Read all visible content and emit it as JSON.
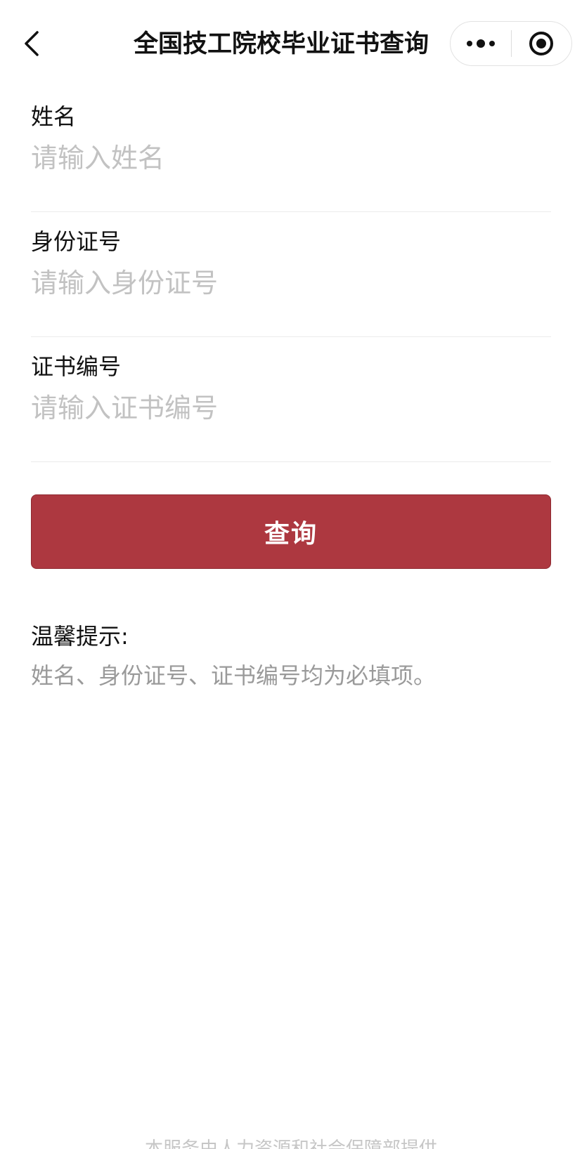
{
  "header": {
    "title": "全国技工院校毕业证书查询",
    "back_icon": "chevron-left-icon",
    "more_icon": "more-dots-icon",
    "close_icon": "target-circle-icon"
  },
  "form": {
    "fields": [
      {
        "label": "姓名",
        "placeholder": "请输入姓名",
        "value": ""
      },
      {
        "label": "身份证号",
        "placeholder": "请输入身份证号",
        "value": ""
      },
      {
        "label": "证书编号",
        "placeholder": "请输入证书编号",
        "value": ""
      }
    ],
    "submit_label": "查询"
  },
  "tips": {
    "title": "温馨提示:",
    "text": "姓名、身份证号、证书编号均为必填项。"
  },
  "footer": {
    "text": "本服务由人力资源和社会保障部提供"
  },
  "colors": {
    "primary_button": "#ad3840",
    "placeholder": "#c2c2c2",
    "tips_text": "#9a9a9a",
    "divider": "#ebebeb"
  }
}
